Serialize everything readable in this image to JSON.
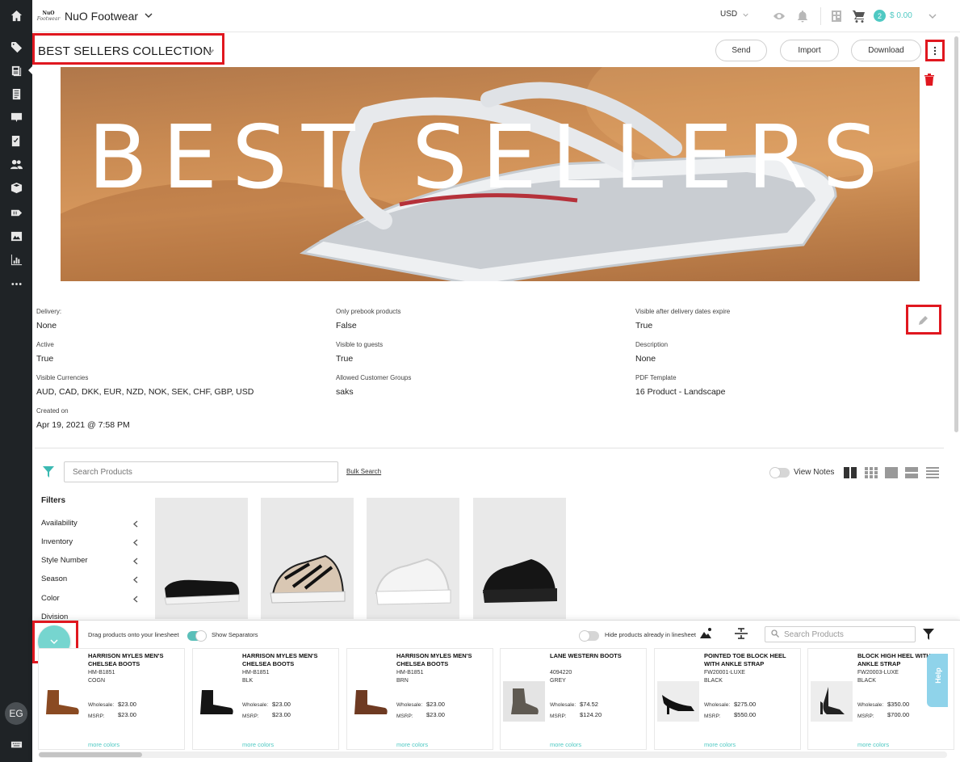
{
  "app": {
    "brand": "NuO Footwear",
    "logo_line1": "NuO",
    "logo_line2": "Footwear",
    "user_initials": "EG"
  },
  "topbar": {
    "currency": "USD",
    "cart_count": "2",
    "cart_total": "$ 0.00"
  },
  "page": {
    "title": "BEST SELLERS COLLECTION",
    "actions": {
      "send": "Send",
      "import": "Import",
      "download": "Download"
    },
    "banner_text": "BEST SELLERS"
  },
  "details": {
    "delivery": {
      "label": "Delivery:",
      "value": "None"
    },
    "only_prebook": {
      "label": "Only prebook products",
      "value": "False"
    },
    "visible_after": {
      "label": "Visible after delivery dates expire",
      "value": "True"
    },
    "active": {
      "label": "Active",
      "value": "True"
    },
    "visible_guests": {
      "label": "Visible to guests",
      "value": "True"
    },
    "description": {
      "label": "Description",
      "value": "None"
    },
    "visible_currencies": {
      "label": "Visible Currencies",
      "value": "AUD, CAD, DKK, EUR, NZD, NOK, SEK, CHF, GBP, USD"
    },
    "allowed_groups": {
      "label": "Allowed Customer Groups",
      "value": "saks"
    },
    "pdf_template": {
      "label": "PDF Template",
      "value": "16 Product - Landscape"
    },
    "created_on": {
      "label": "Created on",
      "value": "Apr 19, 2021 @ 7:58 PM"
    }
  },
  "products": {
    "search_placeholder": "Search Products",
    "bulk_search": "Bulk Search",
    "view_notes": "View Notes",
    "filters_title": "Filters",
    "filters": [
      "Availability",
      "Inventory",
      "Style Number",
      "Season",
      "Color",
      "Division"
    ]
  },
  "drawer": {
    "drag_hint": "Drag products onto your linesheet",
    "show_separators": "Show Separators",
    "hide_in_linesheet": "Hide products already in linesheet",
    "search_placeholder": "Search Products",
    "wholesale_label": "Wholesale:",
    "msrp_label": "MSRP:",
    "more_colors": "more colors",
    "help": "Help",
    "cards": [
      {
        "name": "HARRISON MYLES MEN'S CHELSEA BOOTS",
        "style": "HM-B1851",
        "color": "COGN",
        "wholesale": "$23.00",
        "msrp": "$23.00"
      },
      {
        "name": "HARRISON MYLES MEN'S CHELSEA BOOTS",
        "style": "HM-B1851",
        "color": "BLK",
        "wholesale": "$23.00",
        "msrp": "$23.00"
      },
      {
        "name": "HARRISON MYLES MEN'S CHELSEA BOOTS",
        "style": "HM-B1851",
        "color": "BRN",
        "wholesale": "$23.00",
        "msrp": "$23.00"
      },
      {
        "name": "LANE WESTERN BOOTS",
        "style": "4094220",
        "color": "GREY",
        "wholesale": "$74.52",
        "msrp": "$124.20"
      },
      {
        "name": "POINTED TOE BLOCK HEEL WITH ANKLE STRAP",
        "style": "FW20001-LUXE",
        "color": "BLACK",
        "wholesale": "$275.00",
        "msrp": "$550.00"
      },
      {
        "name": "BLOCK HIGH HEEL WITH ANKLE STRAP",
        "style": "FW20003-LUXE",
        "color": "BLACK",
        "wholesale": "$350.00",
        "msrp": "$700.00"
      }
    ]
  },
  "colors": {
    "accent": "#4fc9c3",
    "highlight": "#e0171f",
    "rail": "#1f2326"
  }
}
